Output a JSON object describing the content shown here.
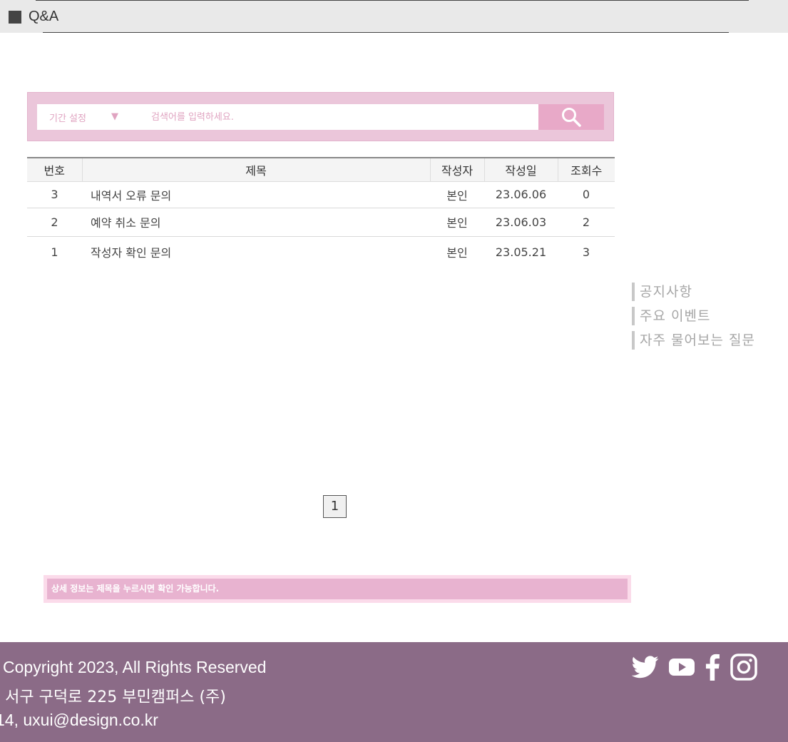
{
  "header": {
    "title": "Q&A"
  },
  "search": {
    "period_label": "기간 설정",
    "period_arrow": "▼",
    "placeholder": "검색어를 입력하세요."
  },
  "table": {
    "columns": [
      "번호",
      "제목",
      "작성자",
      "작성일",
      "조회수"
    ],
    "rows": [
      {
        "no": "3",
        "title": "내역서 오류 문의",
        "author": "본인",
        "date": "23.06.06",
        "views": "0"
      },
      {
        "no": "2",
        "title": "예약 취소 문의",
        "author": "본인",
        "date": "23.06.03",
        "views": "2"
      },
      {
        "no": "1",
        "title": "작성자 확인 문의",
        "author": "본인",
        "date": "23.05.21",
        "views": "3"
      }
    ]
  },
  "side_links": [
    "공지사항",
    "주요 이벤트",
    "자주 물어보는 질문"
  ],
  "pagination": {
    "current": "1"
  },
  "notice": "상세 정보는 제목을 누르시면 확인 가능합니다.",
  "footer": {
    "copyright": "Copyright 2023, All Rights Reserved",
    "address": "l 서구 구덕로 225 부민캠퍼스 (주)",
    "contact": "14, uxui@design.co.kr"
  },
  "colors": {
    "accent_pink": "#e8a9c8",
    "footer_bg": "#8b6b87"
  },
  "social_icons": [
    "twitter-icon",
    "youtube-icon",
    "facebook-icon",
    "instagram-icon"
  ]
}
